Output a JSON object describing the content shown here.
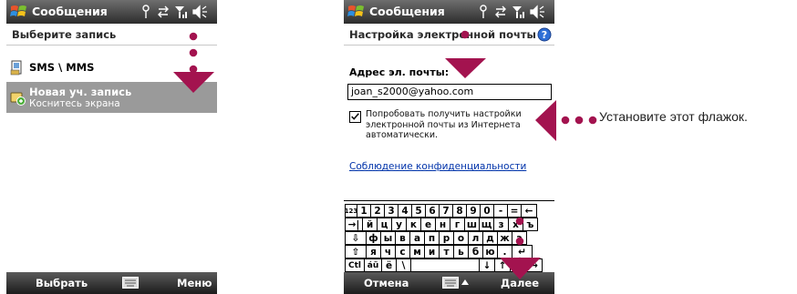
{
  "colors": {
    "annotation": "#a3134f",
    "highlight": "#9a9a9a",
    "link": "#0033aa"
  },
  "screen1": {
    "app_title": "Сообщения",
    "subheader": "Выберите запись",
    "items": [
      {
        "title": "SMS \\ MMS",
        "icon": "sms-icon"
      },
      {
        "title": "Новая уч. запись",
        "subtitle": "Коснитесь экрана",
        "icon": "new-account-icon",
        "selected": true
      }
    ],
    "softkey_left": "Выбрать",
    "softkey_right": "Меню"
  },
  "screen2": {
    "app_title": "Сообщения",
    "subheader": "Настройка электронной почты",
    "email_label": "Адрес эл. почты:",
    "email_value": "joan_s2000@yahoo.com",
    "checkbox_checked": true,
    "checkbox_text": "Попробовать получить настройки электронной почты из Интернета автоматически.",
    "privacy_link": "Соблюдение конфиденциальности",
    "softkey_left": "Отмена",
    "softkey_right": "Далее",
    "keyboard_rows": [
      [
        "123",
        "1",
        "2",
        "3",
        "4",
        "5",
        "6",
        "7",
        "8",
        "9",
        "0",
        "-",
        "=",
        "←"
      ],
      [
        "→|",
        "й",
        "ц",
        "у",
        "к",
        "е",
        "н",
        "г",
        "ш",
        "щ",
        "з",
        "х",
        "ъ"
      ],
      [
        "⇩",
        "ф",
        "ы",
        "в",
        "а",
        "п",
        "р",
        "о",
        "л",
        "д",
        "ж",
        "э"
      ],
      [
        "⇧",
        "я",
        "ч",
        "с",
        "м",
        "и",
        "т",
        "ь",
        "б",
        "ю",
        ".",
        "↵"
      ],
      [
        "Ctl",
        "áü",
        "ё",
        "\\",
        " ",
        "↓",
        "↑",
        "←",
        "→"
      ]
    ]
  },
  "annotation": {
    "text": "Установите этот флажок."
  }
}
